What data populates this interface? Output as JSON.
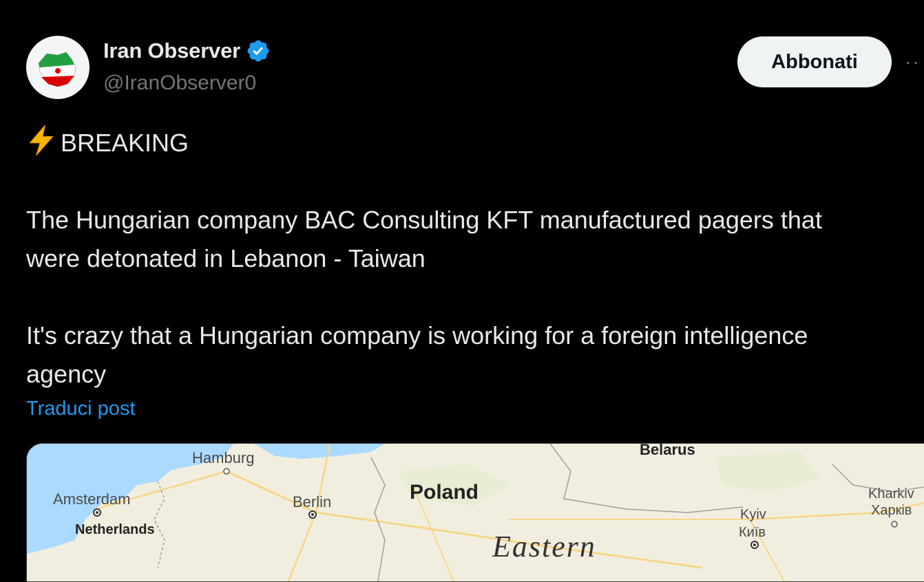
{
  "author": {
    "display_name": "Iran Observer",
    "handle": "@IranObserver0",
    "verified": true,
    "avatar_icon": "iran-map-flag-avatar"
  },
  "actions": {
    "subscribe_label": "Abbonati",
    "more_label": "··"
  },
  "post": {
    "line1": "BREAKING",
    "line1_icon": "lightning-bolt-icon",
    "para1_line1": "The Hungarian company BAC Consulting KFT manufactured pagers that",
    "para1_line2": "were detonated in Lebanon - Taiwan",
    "para2_line1": "It's crazy that a Hungarian company is working for a foreign intelligence",
    "para2_line2": "agency",
    "translate_label": "Traduci post"
  },
  "map": {
    "labels": {
      "hamburg": "Hamburg",
      "amsterdam": "Amsterdam",
      "berlin": "Berlin",
      "netherlands": "Netherlands",
      "poland": "Poland",
      "belarus": "Belarus",
      "kyiv": "Kyiv",
      "kyiv_local": "Київ",
      "kharkiv": "Kharkiv",
      "kharkiv_local": "Харків",
      "eastern": "Eastern"
    }
  },
  "colors": {
    "background": "#000000",
    "text": "#e7e9ea",
    "muted": "#71767b",
    "link": "#1d9bf0",
    "verified": "#1d9bf0",
    "button_bg": "#eff3f4"
  }
}
